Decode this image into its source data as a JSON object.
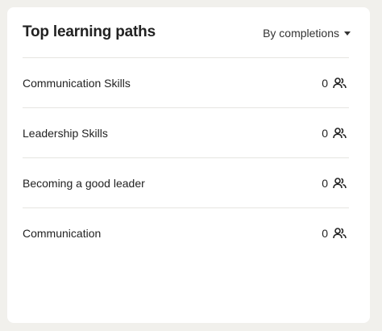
{
  "widget": {
    "title": "Top learning paths",
    "sort_label": "By completions",
    "icons": {
      "sort": "caret-down-icon",
      "count": "users-icon"
    }
  },
  "paths": [
    {
      "name": "Communication Skills",
      "count": "0"
    },
    {
      "name": "Leadership Skills",
      "count": "0"
    },
    {
      "name": "Becoming a good leader",
      "count": "0"
    },
    {
      "name": "Communication",
      "count": "0"
    }
  ],
  "colors": {
    "page_background": "#f1f0ec",
    "card_background": "#ffffff",
    "text": "#222222",
    "divider": "#e6e5e1"
  }
}
